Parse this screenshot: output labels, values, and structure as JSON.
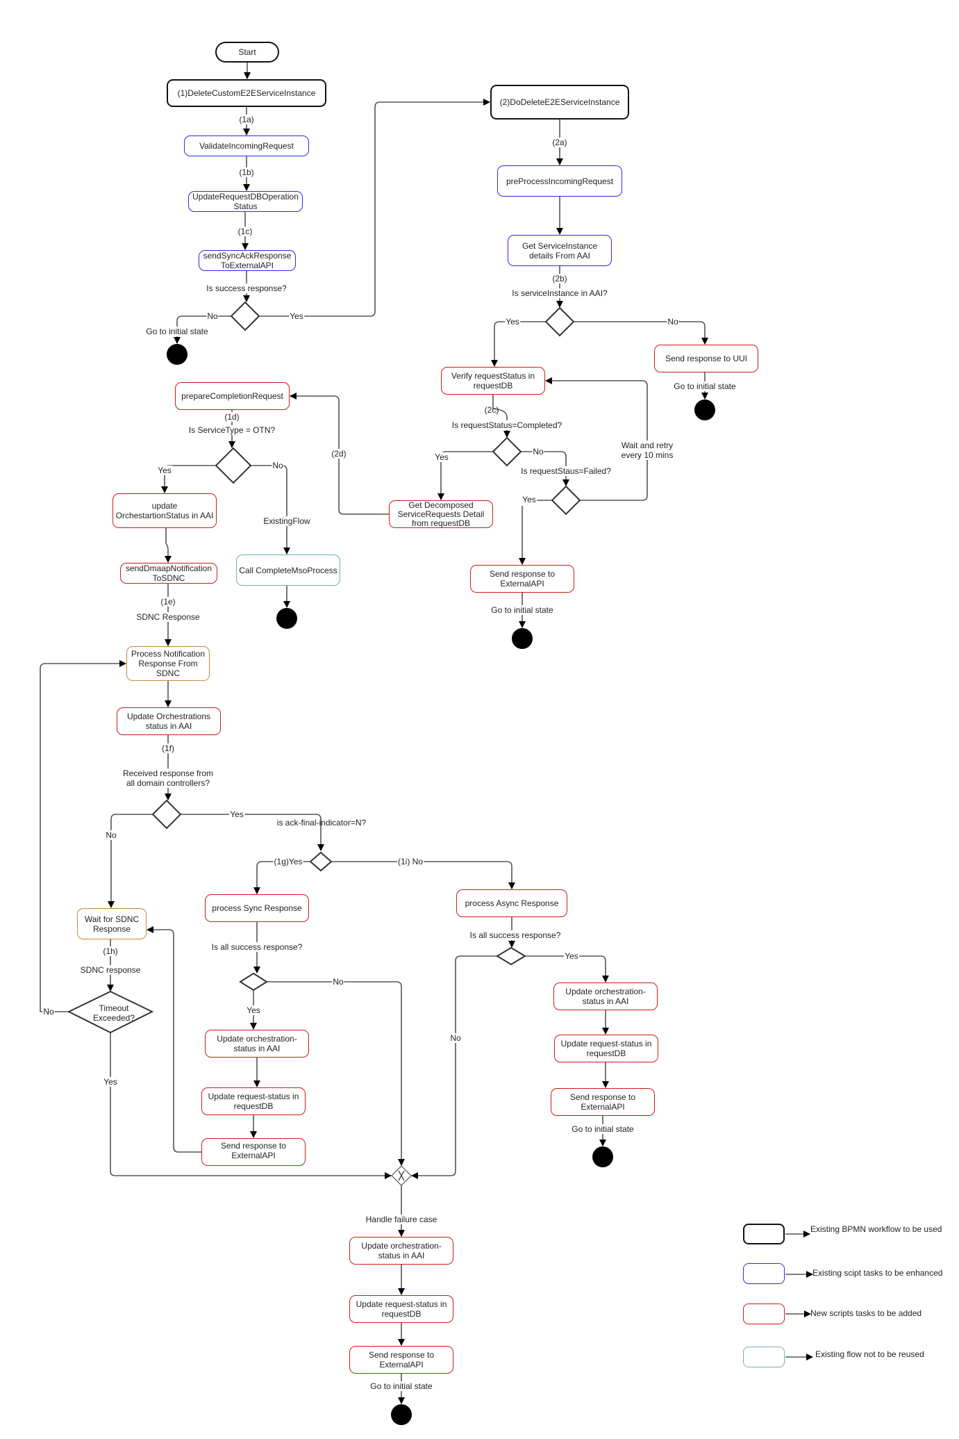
{
  "diagram": {
    "start": "Start",
    "main": {
      "box1": "(1)DeleteCustomE2EServiceInstance",
      "step_1a": "(1a)",
      "validate": "ValidateIncomingRequest",
      "step_1b": "(1b)",
      "update_request_db": "UpdateRequestDBOperation Status",
      "step_1c": "(1c)",
      "send_sync_ack": "sendSyncAckResponse ToExternalAPI",
      "q_success": "Is success response?",
      "no": "No",
      "yes": "Yes",
      "go_initial": "Go to initial state"
    },
    "sub": {
      "box2": "(2)DoDeleteE2EServiceInstance",
      "step_2a": "(2a)",
      "preprocess": "preProcessIncomingRequest",
      "get_si": "Get ServiceInstance details From AAI",
      "step_2b": "(2b)",
      "q_si_in_aai": "Is serviceInstance in AAI?",
      "yes": "Yes",
      "no": "No",
      "send_uui": "Send response to UUI",
      "go_initial_uui": "Go to initial state",
      "verify": "Verify requestStatus in requestDB",
      "step_2c": "(2c)",
      "q_completed": "Is requestStatus=Completed?",
      "yes_completed": "Yes",
      "no_completed": "No",
      "q_failed": "Is requestStaus=Failed?",
      "yes_failed": "Yes",
      "wait_retry": "Wait and retry every 10 mins",
      "get_decomposed": "Get Decomposed ServiceRequests Detail from requestDB",
      "send_external": "Send response to ExternalAPI",
      "go_initial_external": "Go to initial state",
      "step_2d": "(2d)"
    },
    "completion": {
      "prepare": "prepareCompletionRequest",
      "step_1d": "(1d)",
      "q_otn": "Is ServiceType = OTN?",
      "yes": "Yes",
      "no": "No",
      "update_orch_status": "update OrchestartionStatus in AAI",
      "existing_flow": "ExistingFlow",
      "call_complete": "Call CompleteMsoProcess",
      "send_dmaap": "sendDmaapNotification ToSDNC",
      "step_1e": "(1e)",
      "sdnc_response": "SDNC Response",
      "process_notification": "Process Notification Response From SDNC",
      "update_orchestrations": "Update Orchestrations status in AAI",
      "step_1f": "(1f)",
      "q_all_domains": "Received response from all domain controllers?",
      "no_all": "No",
      "yes_all": "Yes",
      "q_ack_final": "is ack-final-indicator=N?",
      "yes_1g": "(1g)Yes",
      "no_1i": "(1i) No"
    },
    "wait": {
      "wait_sdnc": "Wait for SDNC Response",
      "step_1h": "(1h)",
      "sdnc_response": "SDNC response",
      "timeout": "Timeout Exceeded?",
      "no": "No",
      "yes": "Yes"
    },
    "sync": {
      "process": "process Sync Response",
      "q_all_success": "Is all success response?",
      "yes": "Yes",
      "no": "No",
      "update_orch": "Update orchestration-status in AAI",
      "update_req": "Update request-status in requestDB",
      "send": "Send response to ExternalAPI"
    },
    "async": {
      "process": "process Async Response",
      "q_all_success": "Is all success response?",
      "yes": "Yes",
      "no": "No",
      "update_orch": "Update orchestration-status in AAI",
      "update_req": "Update request-status in requestDB",
      "send": "Send response to ExternalAPI",
      "go_initial": "Go to initial state"
    },
    "failure": {
      "handle": "Handle failure case",
      "update_orch": "Update orchestration-status in AAI",
      "update_req": "Update request-status in requestDB",
      "send": "Send response to ExternalAPI",
      "go_initial": "Go to initial state"
    }
  },
  "legend": {
    "items": [
      {
        "label": "Existing BPMN workflow to be used",
        "color": "#111111"
      },
      {
        "label": "Existing scipt tasks to be enhanced",
        "color": "#2a2aee"
      },
      {
        "label": "New scripts tasks to be added",
        "color": "#cc1a1a"
      },
      {
        "label": "Existing flow not to be reused",
        "color": "#7aaab8"
      }
    ]
  },
  "colors": {
    "bpmn": "#111111",
    "existing_script": "#2a2aee",
    "new_script": "#cc1a1a",
    "not_reused": "#7aaab8",
    "pending": "#c8873a"
  }
}
